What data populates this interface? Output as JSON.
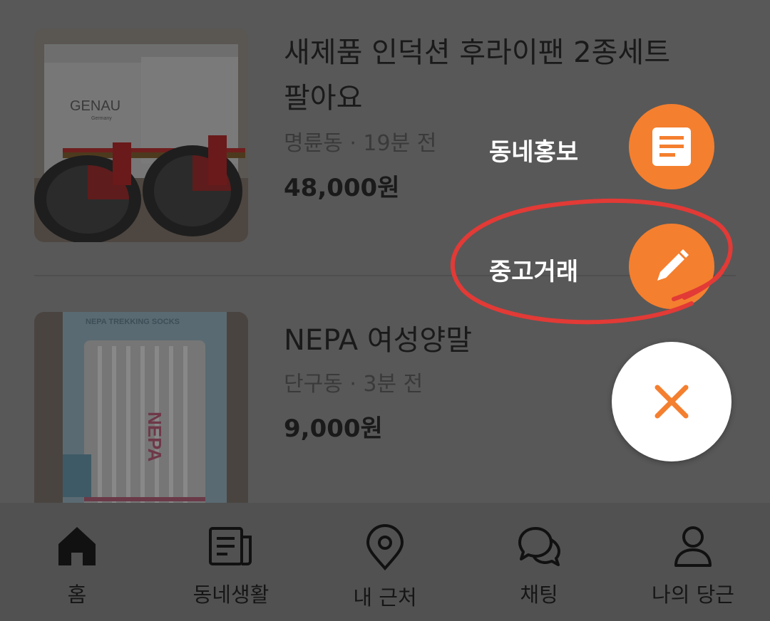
{
  "listings": [
    {
      "title": "새제품 인덕션 후라이팬 2종세트 팔아요",
      "meta": "명륜동 · 19분 전",
      "price": "48,000원",
      "image_brand": "GENAU",
      "image_sub": "Germany"
    },
    {
      "title": "NEPA 여성양말",
      "meta": "단구동 · 3분 전",
      "price": "9,000원",
      "image_brand": "NEPA TREKKING SOCKS"
    }
  ],
  "fab_menu": {
    "promo_label": "동네홍보",
    "promo_icon": "document-icon",
    "used_trade_label": "중고거래",
    "used_trade_icon": "pencil-icon",
    "close_icon": "close-icon",
    "accent_color": "#f47f2f"
  },
  "annotation": {
    "color": "#e23a36",
    "shape": "hand-drawn ellipse around 중고거래 option"
  },
  "bottom_nav": [
    {
      "label": "홈",
      "icon": "home-icon"
    },
    {
      "label": "동네생활",
      "icon": "newspaper-icon"
    },
    {
      "label": "내 근처",
      "icon": "location-pin-icon"
    },
    {
      "label": "채팅",
      "icon": "chat-bubbles-icon"
    },
    {
      "label": "나의 당근",
      "icon": "person-icon"
    }
  ]
}
